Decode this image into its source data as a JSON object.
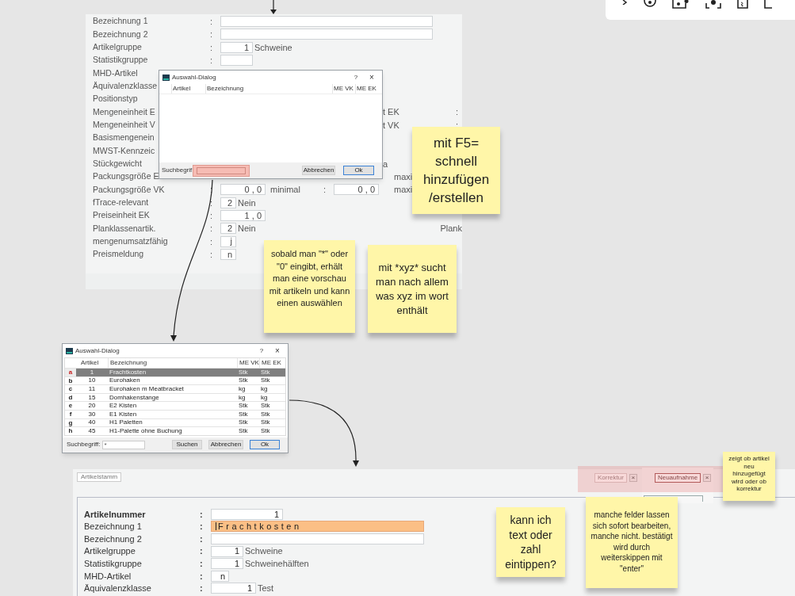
{
  "form_top": {
    "rows": [
      {
        "label": "Bezeichnung 1",
        "colon": ":",
        "cells": [
          {
            "kind": "longfield"
          }
        ]
      },
      {
        "label": "Bezeichnung 2",
        "colon": ":",
        "cells": [
          {
            "kind": "longfield"
          }
        ]
      },
      {
        "label": "Artikelgruppe",
        "colon": ":",
        "cells": [
          {
            "kind": "field",
            "value": "1"
          },
          {
            "kind": "text",
            "text": "Schweine"
          }
        ]
      },
      {
        "label": "Statistikgruppe",
        "colon": ":",
        "cells": [
          {
            "kind": "field"
          }
        ]
      },
      {
        "label": "MHD-Artikel"
      },
      {
        "label": "Äquivalenzklasse"
      },
      {
        "label": "Positionstyp"
      },
      {
        "label": "Mengeneinheit E",
        "right": {
          "text": "t EK",
          "kind": "start",
          "colon": ":"
        }
      },
      {
        "label": "Mengeneinheit V",
        "right": {
          "text": "t VK",
          "kind": "start",
          "colon": ":"
        }
      },
      {
        "label": "Basismengenein"
      },
      {
        "label": "MWST-Kennzeic"
      },
      {
        "label": "Stückgewicht",
        "right": {
          "text": "a",
          "kind": "start"
        }
      },
      {
        "label": "Packungsgröße E",
        "right": {
          "text": "maxi",
          "kind": "mid"
        }
      },
      {
        "label": "Packungsgröße VK",
        "colon": ":",
        "cells": [
          {
            "kind": "numfield",
            "value": "0 , 0"
          },
          {
            "kind": "caption",
            "text": "minimal"
          },
          {
            "kind": "colon",
            "text": ":"
          },
          {
            "kind": "numfield",
            "value": "0 , 0"
          }
        ],
        "right": {
          "text": "maxi",
          "kind": "mid"
        }
      },
      {
        "label": "fTrace-relevant",
        "colon": ":",
        "cells": [
          {
            "kind": "shortfield",
            "value": "2"
          },
          {
            "kind": "text",
            "text": "Nein"
          }
        ]
      },
      {
        "label": "Preiseinheit  EK",
        "colon": ":",
        "cells": [
          {
            "kind": "numfield",
            "value": "1 , 0"
          }
        ]
      },
      {
        "label": "Planklassenartik.",
        "colon": ":",
        "cells": [
          {
            "kind": "shortfield",
            "value": "2"
          },
          {
            "kind": "text",
            "text": "Nein"
          }
        ],
        "right": {
          "text": "Plank",
          "kind": "end"
        }
      },
      {
        "label": "mengenumsatzfähig",
        "colon": ":",
        "cells": [
          {
            "kind": "shortfield",
            "value": "j"
          }
        ]
      },
      {
        "label": "Preismeldung",
        "colon": ":",
        "cells": [
          {
            "kind": "shortfield",
            "value": "n"
          }
        ]
      }
    ]
  },
  "dialog_empty": {
    "title": "Auswahl-Dialog",
    "help": "?",
    "close": "×",
    "columns": [
      "Artikel",
      "Bezeichnung",
      "ME VK",
      "ME EK"
    ],
    "search_label": "Suchbegrif",
    "buttons": [
      {
        "label": "Abbrechen",
        "default": false
      },
      {
        "label": "Ok",
        "default": true
      }
    ]
  },
  "dialog_list": {
    "title": "Auswahl-Dialog",
    "help": "?",
    "close": "×",
    "columns": [
      "Artikel",
      "Bezeichnung",
      "ME VK",
      "ME EK"
    ],
    "rows": [
      {
        "key": "a",
        "artikel": "1",
        "bezeichnung": "Frachtkosten",
        "me_vk": "Stk",
        "me_ek": "Stk",
        "selected": true
      },
      {
        "key": "b",
        "artikel": "10",
        "bezeichnung": "Eurohaken",
        "me_vk": "Stk",
        "me_ek": "Stk",
        "selected": false
      },
      {
        "key": "c",
        "artikel": "11",
        "bezeichnung": "Eurohaken m Meatbracket",
        "me_vk": "kg",
        "me_ek": "kg",
        "selected": false
      },
      {
        "key": "d",
        "artikel": "15",
        "bezeichnung": "Domhakenstange",
        "me_vk": "kg",
        "me_ek": "kg",
        "selected": false
      },
      {
        "key": "e",
        "artikel": "20",
        "bezeichnung": "E2 Kisten",
        "me_vk": "Stk",
        "me_ek": "Stk",
        "selected": false
      },
      {
        "key": "f",
        "artikel": "30",
        "bezeichnung": "E1 Kisten",
        "me_vk": "Stk",
        "me_ek": "Stk",
        "selected": false
      },
      {
        "key": "g",
        "artikel": "40",
        "bezeichnung": "H1 Paletten",
        "me_vk": "Stk",
        "me_ek": "Stk",
        "selected": false
      },
      {
        "key": "h",
        "artikel": "45",
        "bezeichnung": "H1-Palette ohne Buchung",
        "me_vk": "Stk",
        "me_ek": "Stk",
        "selected": false
      }
    ],
    "search_label": "Suchbegriff:",
    "search_value": "*",
    "buttons": [
      {
        "label": "Suchen",
        "default": false
      },
      {
        "label": "Abbrechen",
        "default": false
      },
      {
        "label": "Ok",
        "default": true
      }
    ]
  },
  "form_bottom": {
    "tab": "Artikelstamm",
    "mode_buttons": [
      {
        "label": "Korrektur",
        "close": "×",
        "active": false
      },
      {
        "label": "Neuaufnahme",
        "close": "×",
        "active": true
      }
    ],
    "rows": [
      {
        "label": "Artikelnummer",
        "bold": true,
        "colon": ":",
        "field": {
          "kind": "wide",
          "value": "1",
          "highlighted": false
        }
      },
      {
        "label": "Bezeichnung 1",
        "bold": false,
        "colon": ":",
        "field": {
          "kind": "long",
          "value": "Frachtkosten",
          "highlighted": true
        }
      },
      {
        "label": "Bezeichnung 2",
        "bold": false,
        "colon": ":",
        "field": {
          "kind": "long",
          "highlighted": false
        }
      },
      {
        "label": "Artikelgruppe",
        "bold": false,
        "colon": ":",
        "field": {
          "kind": "small",
          "value": "1",
          "highlighted": false
        },
        "text": "Schweine"
      },
      {
        "label": "Statistikgruppe",
        "bold": false,
        "colon": ":",
        "field": {
          "kind": "small",
          "value": "1",
          "highlighted": false
        },
        "text": "Schweinehälften"
      },
      {
        "label": "MHD-Artikel",
        "bold": false,
        "colon": ":",
        "field": {
          "kind": "short",
          "value": "n",
          "highlighted": false
        }
      },
      {
        "label": "Äquivalenzklasse",
        "bold": false,
        "colon": ":",
        "field": {
          "kind": "medium",
          "value": "1",
          "highlighted": false
        },
        "text": "Test"
      }
    ]
  },
  "notes": [
    {
      "kind": "large",
      "text": "mit F5= schnell hinzufügen /erstellen"
    },
    {
      "kind": "small",
      "text": "sobald man \"*\" oder \"0\" eingibt, erhält man eine vorschau mit artikeln und kann einen auswählen"
    },
    {
      "kind": "medium",
      "text": "mit *xyz* sucht man nach allem was xyz im wort enthält"
    },
    {
      "kind": "big",
      "text": "kann ich text oder zahl eintippen?"
    },
    {
      "kind": "tiny",
      "text": "manche felder lassen sich sofort bearbeiten, manche nicht. bestätigt wird durch weiterskippen mit \"enter\""
    },
    {
      "kind": "micro",
      "text": "zeigt ob artikel neu hinzugefügt wird oder ob korrektur"
    }
  ]
}
